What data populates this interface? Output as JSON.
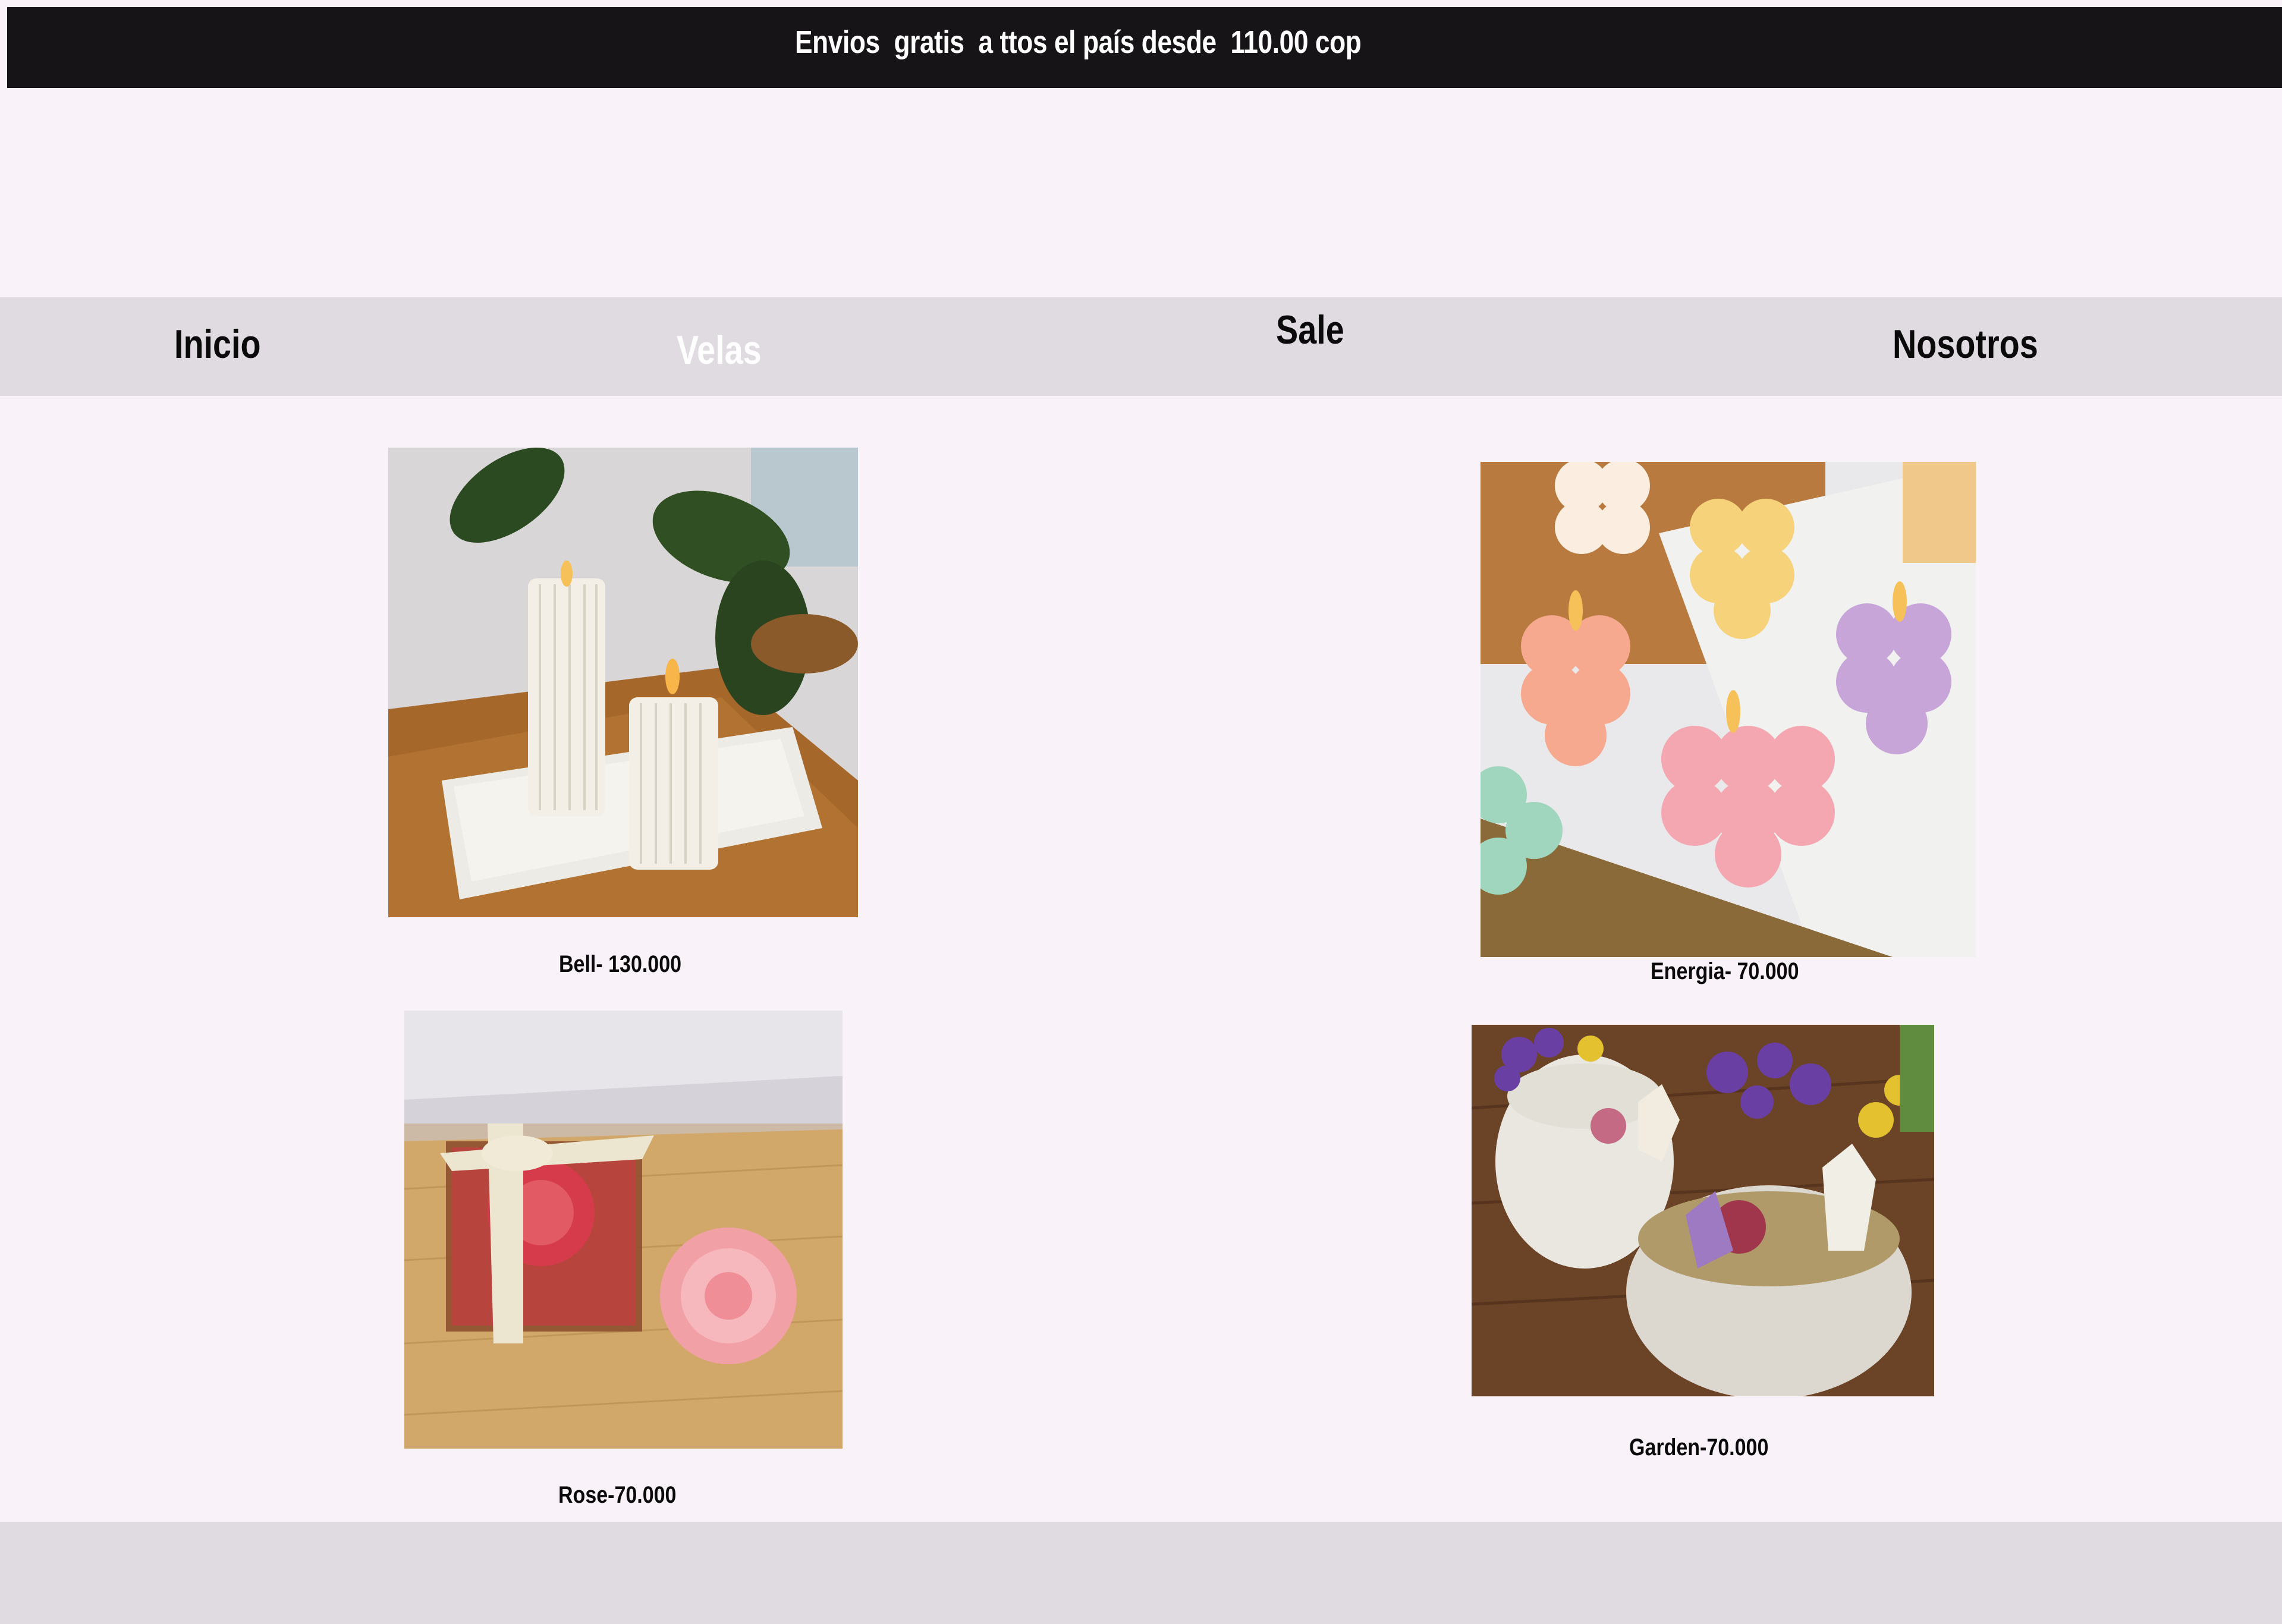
{
  "banner": {
    "text": "Envios  gratis  a ttos el país desde  110.00 cop"
  },
  "nav": {
    "items": [
      {
        "label": "Inicio"
      },
      {
        "label": "Velas",
        "active": true
      },
      {
        "label": "Sale"
      },
      {
        "label": "Nosotros"
      }
    ]
  },
  "products": [
    {
      "label": "Bell- 130.000",
      "image": "pillar-candles-photo"
    },
    {
      "label": "Energia- 70.000",
      "image": "bubble-cube-candles-photo"
    },
    {
      "label": "Rose-70.000",
      "image": "rose-candle-gift-box-photo"
    },
    {
      "label": "Garden-70.000",
      "image": "crystal-flower-candles-photo"
    }
  ],
  "colors": {
    "page_background": "#f9f3f9",
    "banner_background": "#161417",
    "nav_background": "#e0dae1",
    "nav_active_text": "#ffffff",
    "text": "#0a0a0a"
  }
}
